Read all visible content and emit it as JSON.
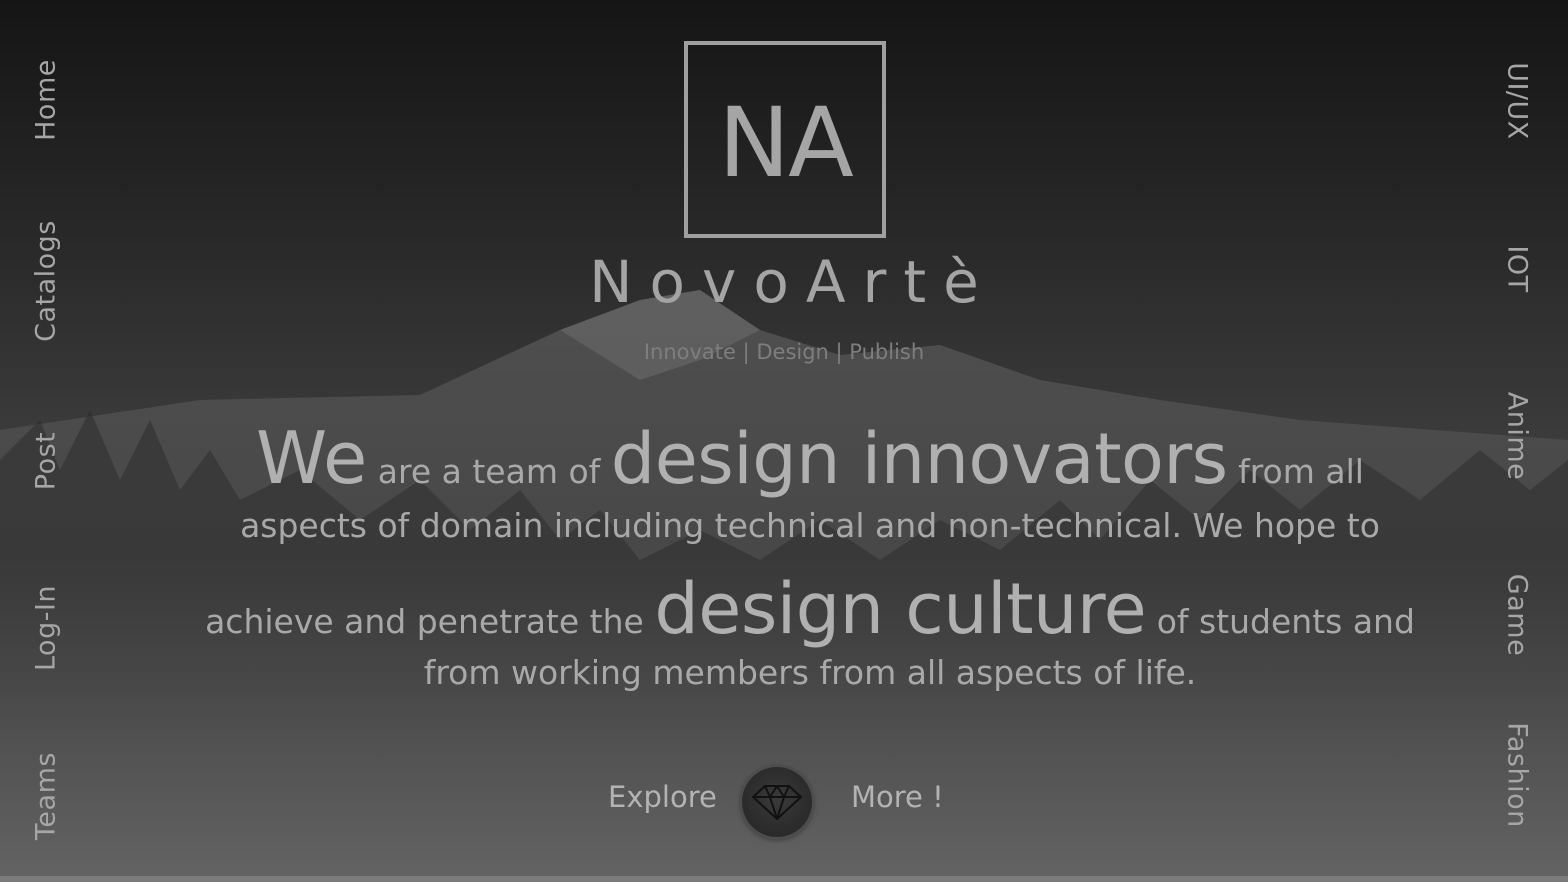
{
  "nav_left": {
    "items": [
      {
        "label": "Home"
      },
      {
        "label": "Catalogs"
      },
      {
        "label": "Post"
      },
      {
        "label": "Log-In"
      },
      {
        "label": "Teams"
      }
    ]
  },
  "nav_right": {
    "items": [
      {
        "label": "UI/UX"
      },
      {
        "label": "IOT"
      },
      {
        "label": "Anime"
      },
      {
        "label": "Game"
      },
      {
        "label": "Fashion"
      }
    ]
  },
  "logo": {
    "letters": "NA",
    "brand": "NovoArtè",
    "tagline": "Innovate | Design | Publish"
  },
  "mission": {
    "we": "We",
    "s1": " are a team of ",
    "emph1": "design innovators",
    "s2": " from all",
    "line2": "aspects of domain including technical and non-technical. We hope to",
    "s3": "achieve and penetrate the ",
    "emph2": "design culture",
    "s4": " of students and",
    "line4": "from working members from all aspects of life."
  },
  "cta": {
    "explore_label": "Explore",
    "more_label": "More !",
    "icon": "diamond-icon"
  },
  "colors": {
    "text": "#a9a9a9",
    "background_top": "#151515",
    "background_bottom": "#616161"
  }
}
